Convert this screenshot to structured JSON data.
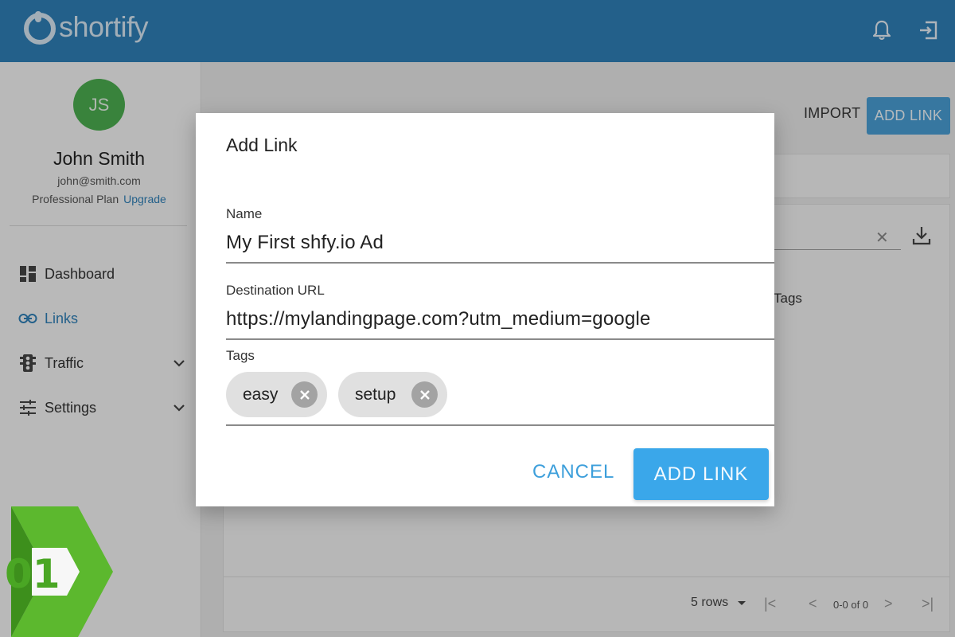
{
  "app": {
    "brand": "shortify",
    "brand_color": "#2f80b8"
  },
  "header": {
    "notification_icon": "bell-icon",
    "logout_icon": "exit-icon"
  },
  "sidebar": {
    "avatar_initials": "JS",
    "avatar_color": "#4caf50",
    "user_name": "John Smith",
    "user_email": "john@smith.com",
    "plan": "Professional Plan",
    "upgrade": "Upgrade",
    "items": [
      {
        "label": "Dashboard",
        "icon": "dashboard-icon"
      },
      {
        "label": "Links",
        "icon": "link-icon",
        "active": true
      },
      {
        "label": "Traffic",
        "icon": "traffic-light-icon",
        "expandable": true
      },
      {
        "label": "Settings",
        "icon": "sliders-icon",
        "expandable": true
      }
    ]
  },
  "main": {
    "import_label": "IMPORT",
    "add_link_label": "ADD LINK",
    "tags_column": "Tags",
    "rows_per_page": "5 rows",
    "page_info": "0-0 of 0"
  },
  "dialog": {
    "title": "Add Link",
    "name_label": "Name",
    "name_value": "My First shfy.io Ad",
    "url_label": "Destination URL",
    "url_value": "https://mylandingpage.com?utm_medium=google",
    "tags_label": "Tags",
    "tags": [
      "easy",
      "setup"
    ],
    "cancel_label": "CANCEL",
    "submit_label": "ADD LINK"
  },
  "step_badge": {
    "number": "01",
    "color": "#5cb82e"
  }
}
